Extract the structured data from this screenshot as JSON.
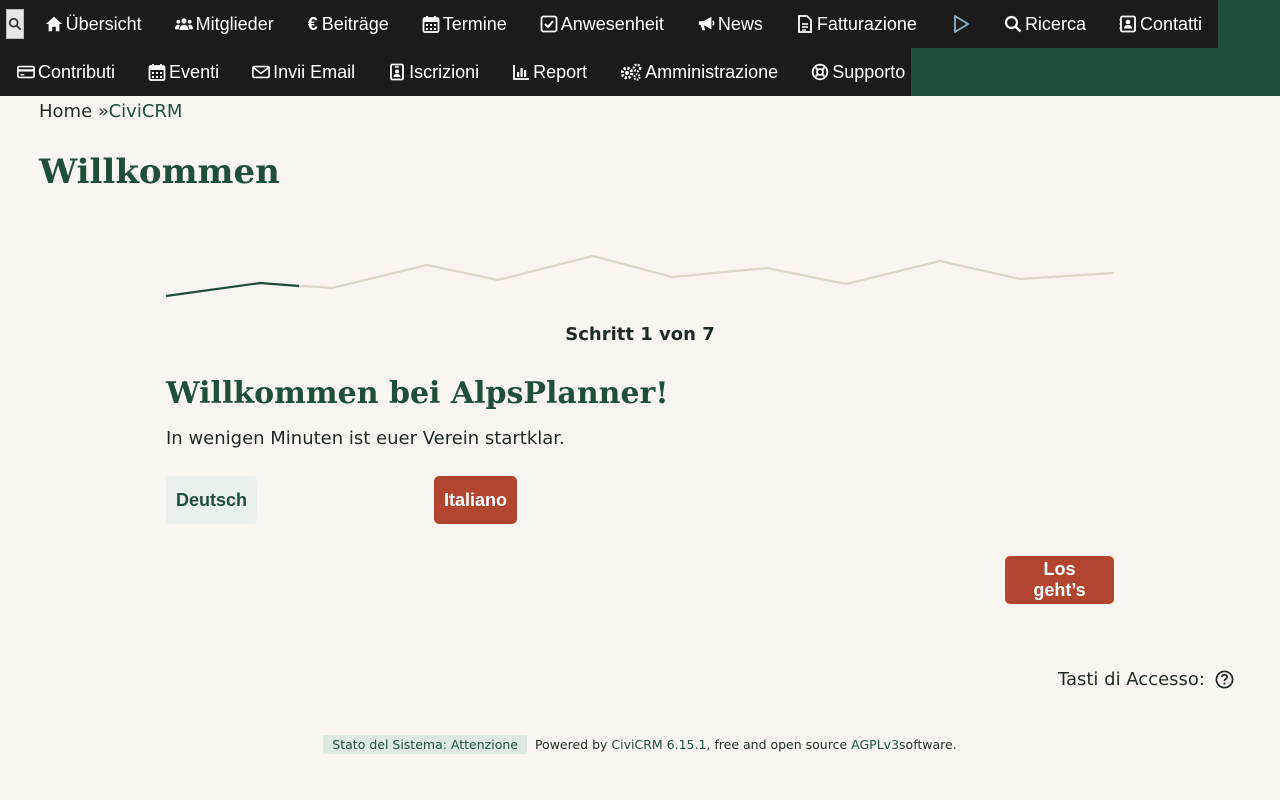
{
  "menu": {
    "row1": [
      {
        "label": "Übersicht",
        "icon": "home-icon"
      },
      {
        "label": "Mitglieder",
        "icon": "users-icon"
      },
      {
        "label": "Beiträge",
        "icon": "euro-icon"
      },
      {
        "label": "Termine",
        "icon": "calendar-icon"
      },
      {
        "label": "Anwesenheit",
        "icon": "check-square-icon"
      },
      {
        "label": "News",
        "icon": "megaphone-icon"
      },
      {
        "label": "Fatturazione",
        "icon": "document-icon"
      },
      {
        "label": "Ricerca",
        "icon": "search-icon"
      },
      {
        "label": "Contatti",
        "icon": "contact-card-icon"
      }
    ],
    "row2": [
      {
        "label": "Contributi",
        "icon": "credit-card-icon"
      },
      {
        "label": "Eventi",
        "icon": "calendar-icon"
      },
      {
        "label": "Invii Email",
        "icon": "envelope-icon"
      },
      {
        "label": "Iscrizioni",
        "icon": "id-badge-icon"
      },
      {
        "label": "Report",
        "icon": "bar-chart-icon"
      },
      {
        "label": "Amministrazione",
        "icon": "gears-icon"
      },
      {
        "label": "Supporto",
        "icon": "lifebuoy-icon"
      }
    ]
  },
  "breadcrumb": {
    "home": "Home",
    "separator": "»",
    "current": "CiviCRM"
  },
  "page": {
    "title": "Willkommen"
  },
  "wizard": {
    "step_text": "Schritt 1 von 7",
    "current_step": 1,
    "total_steps": 7,
    "title": "Willkommen bei AlpsPlanner!",
    "intro": "In wenigen Minuten ist euer Verein startklar.",
    "lang_de": "Deutsch",
    "lang_it": "Italiano",
    "start_button": "Los geht’s"
  },
  "access_keys": {
    "label": "Tasti di Accesso:"
  },
  "footer": {
    "status": "Stato del Sistema: Attenzione",
    "powered_prefix": "Powered by ",
    "civicrm_link": "CiviCRM 6.15.1",
    "middle": ", free and open source ",
    "license_link": "AGPLv3",
    "suffix": " software."
  },
  "colors": {
    "menu_bg": "#1b1b1b",
    "brand_green": "#1f4e3b",
    "accent_red": "#b14530",
    "page_bg": "#f9f6f1"
  }
}
